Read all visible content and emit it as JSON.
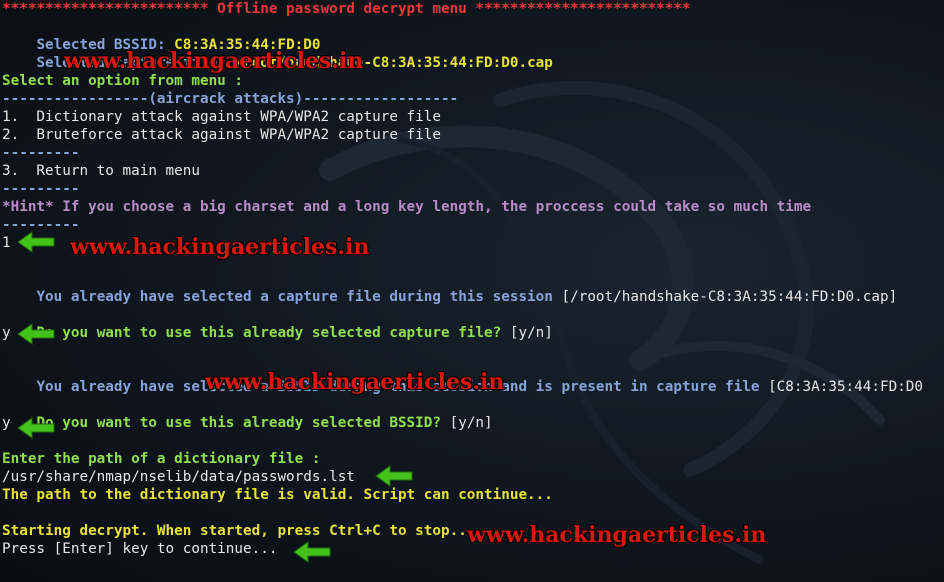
{
  "menu": {
    "header": "************************ Offline password decrypt menu *************************",
    "bssid_label": "Selected BSSID: ",
    "bssid_value": "C8:3A:35:44:FD:D0",
    "capture_label": "Selected capture file: ",
    "capture_value": "/root/handshake-C8:3A:35:44:FD:D0.cap",
    "prompt": "Select an option from menu :",
    "section": "-----------------(aircrack attacks)------------------",
    "opt1": "1.  Dictionary attack against WPA/WPA2 capture file",
    "opt2": "2.  Bruteforce attack against WPA/WPA2 capture file",
    "sep1": "---------",
    "opt3": "3.  Return to main menu",
    "sep2": "---------",
    "hint": "*Hint* If you choose a big charset and a long key length, the proccess could take so much time",
    "sep3": "---------",
    "input1": "1"
  },
  "session": {
    "capture_msg": "You already have selected a capture file during this session ",
    "capture_path": "[/root/handshake-C8:3A:35:44:FD:D0.cap]",
    "q_capture": "Do you want to use this already selected capture file?",
    "yn1": " [y/n]",
    "ans1": "y",
    "bssid_msg": "You already have selected a BSSID during this session and is present in capture file ",
    "bssid_val": "[C8:3A:35:44:FD:D0",
    "q_bssid": "Do you want to use this already selected BSSID?",
    "yn2": " [y/n]",
    "ans2": "y",
    "dict_prompt": "Enter the path of a dictionary file :",
    "dict_path": "/usr/share/nmap/nselib/data/passwords.lst",
    "valid_msg": "The path to the dictionary file is valid. Script can continue...",
    "start_msg": "Starting decrypt. When started, press Ctrl+C to stop...",
    "continue_msg": "Press [Enter] key to continue..."
  },
  "watermark": {
    "text": "www.hackingaerticles.in"
  },
  "colors": {
    "red": "#e8393a",
    "blue": "#87a3d9",
    "yellow": "#e8e23a",
    "green": "#8fe051",
    "purple": "#b98cc8",
    "arrow": "#43c21a",
    "watermark": "#d8180f"
  }
}
